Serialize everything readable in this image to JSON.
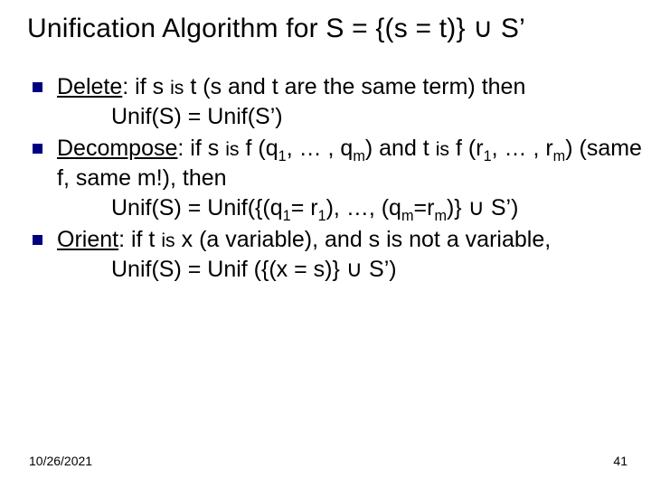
{
  "title_parts": {
    "a": "Unification Algorithm for S = {(s = t)} ",
    "cup": "∪",
    "b": " S’"
  },
  "items": [
    {
      "lead_u": "Delete",
      "lead_after": ": if s ",
      "is1": "is",
      "mid1": " t (s and t are the same term) then",
      "indent": "Unif(S) = Unif(S’)"
    },
    {
      "lead_u": "Decompose",
      "lead_after": ": if s ",
      "is1": "is",
      "mid1": " f (q",
      "sub1": "1",
      "mid2": ", … , q",
      "sub2": "m",
      "mid3": ") and t ",
      "is2": "is",
      "mid4": " f (r",
      "sub3": "1",
      "mid5": ", … , r",
      "sub4": "m",
      "mid6": ") (same f, same m!), then",
      "indent_a": "Unif(S) = Unif({(q",
      "isub1": "1",
      "indent_b": "= r",
      "isub2": "1",
      "indent_c": "), …, (q",
      "isub3": "m",
      "indent_d": "=r",
      "isub4": "m",
      "indent_e": ")} ",
      "cup": "∪",
      "indent_f": " S’)"
    },
    {
      "lead_u": "Orient",
      "lead_after": ": if t ",
      "is1": "is",
      "mid1": " x (a variable), and s is not a variable,",
      "indent_a": "Unif(S) = Unif ({(x = s)} ",
      "cup": "∪",
      "indent_b": " S’)"
    }
  ],
  "footer": {
    "date": "10/26/2021",
    "page": "41"
  }
}
